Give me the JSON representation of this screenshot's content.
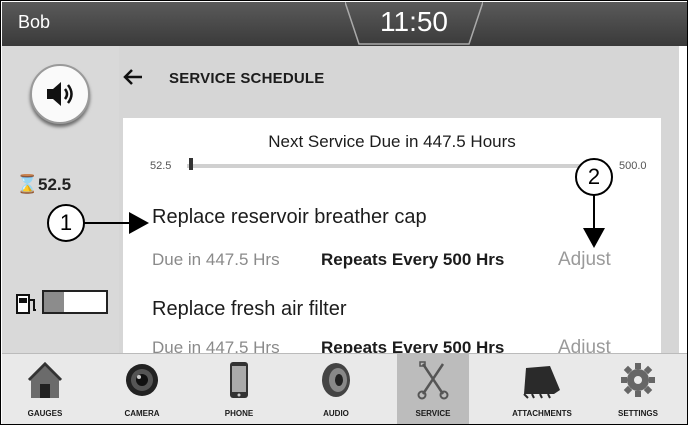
{
  "header": {
    "operator": "Bob",
    "time": "11:50"
  },
  "sidebar": {
    "volume_icon": "speaker-icon",
    "hour_icon": "hourglass-icon",
    "hour_symbol": "⌛",
    "hours": "52.5",
    "fuel_icon": "fuel-pump-icon",
    "fuel_level": 0.33
  },
  "schedule": {
    "title": "SERVICE SCHEDULE",
    "next_due": "Next Service Due in 447.5 Hours",
    "slider_min": "52.5",
    "slider_max": "500.0",
    "tasks": [
      {
        "name": "Replace reservoir breather cap",
        "due": "Due in 447.5 Hrs",
        "repeats": "Repeats Every 500 Hrs",
        "adjust": "Adjust"
      },
      {
        "name": "Replace fresh air filter",
        "due": "Due in 447.5 Hrs",
        "repeats": "Repeats Every 500 Hrs",
        "adjust": "Adjust"
      }
    ]
  },
  "callouts": [
    "1",
    "2"
  ],
  "nav": [
    {
      "label": "GAUGES",
      "icon": "house-icon"
    },
    {
      "label": "CAMERA",
      "icon": "camera-lens-icon"
    },
    {
      "label": "PHONE",
      "icon": "phone-icon"
    },
    {
      "label": "AUDIO",
      "icon": "speaker-icon"
    },
    {
      "label": "SERVICE",
      "icon": "wrench-icon",
      "active": true
    },
    {
      "label": "ATTACHMENTS",
      "icon": "bucket-icon"
    },
    {
      "label": "SETTINGS",
      "icon": "gear-icon"
    }
  ]
}
